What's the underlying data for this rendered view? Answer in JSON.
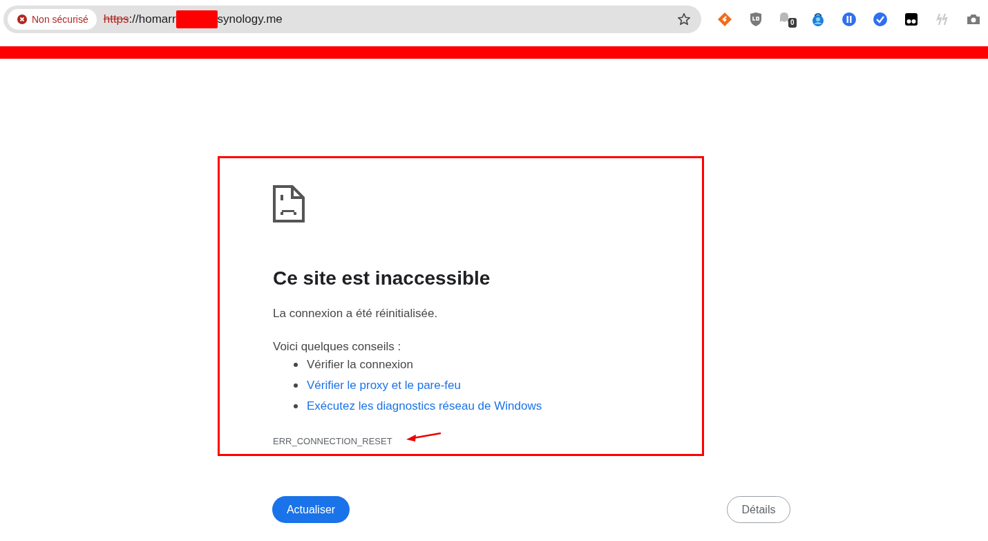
{
  "address_bar": {
    "security_label": "Non sécurisé",
    "url_scheme": "https",
    "url_rest_start": "://homarr",
    "url_rest_end": "synology.me"
  },
  "extensions": [
    {
      "kind": "orange"
    },
    {
      "kind": "shield"
    },
    {
      "kind": "ghost",
      "badge": "0"
    },
    {
      "kind": "lock"
    },
    {
      "kind": "pause"
    },
    {
      "kind": "check"
    },
    {
      "kind": "glasses"
    },
    {
      "kind": "slash"
    },
    {
      "kind": "camera"
    }
  ],
  "error": {
    "title": "Ce site est inaccessible",
    "description": "La connexion a été réinitialisée.",
    "tips_heading": "Voici quelques conseils :",
    "tips": [
      {
        "text": "Vérifier la connexion",
        "kind": "plain"
      },
      {
        "text": "Vérifier le proxy et le pare-feu",
        "kind": "link"
      },
      {
        "text": "Exécutez les diagnostics réseau de Windows",
        "kind": "link"
      }
    ],
    "code": "ERR_CONNECTION_RESET"
  },
  "buttons": [
    {
      "label": "Actualiser",
      "kind": "primary"
    },
    {
      "label": "Détails",
      "kind": "secondary"
    }
  ]
}
